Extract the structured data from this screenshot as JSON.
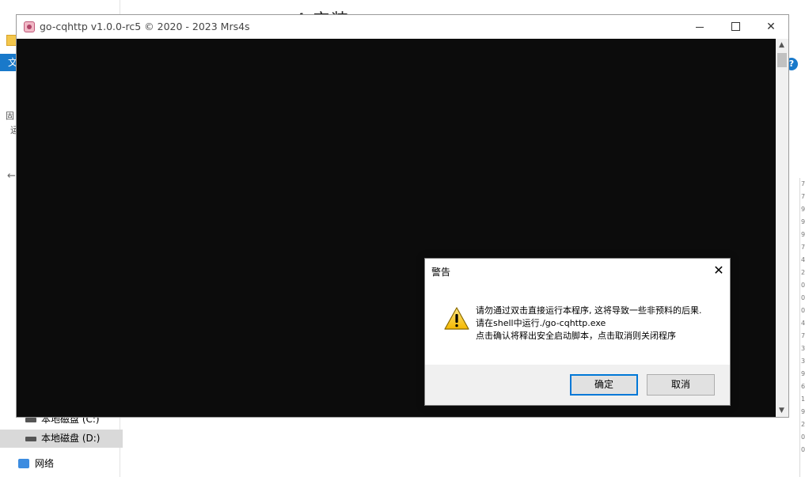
{
  "explorer": {
    "title_fragment": "4.安装 ...",
    "ribbon_tab": "文",
    "help": "?",
    "left_text_1": "固",
    "left_text_2": "运",
    "nav": [
      {
        "label": "本地磁盘 (C:)"
      },
      {
        "label": "本地磁盘 (D:)"
      },
      {
        "label": "网络"
      }
    ],
    "right_column_digits": [
      "7",
      "7",
      "9",
      "9",
      "9",
      "7",
      "4",
      "2",
      "0",
      "0",
      "0",
      "4",
      "7",
      "3",
      "3",
      "9",
      "6",
      "1",
      "9",
      "2",
      "0",
      "0."
    ]
  },
  "console": {
    "title": "go-cqhttp v1.0.0-rc5 © 2020 - 2023 Mrs4s",
    "minimize": "–",
    "maximize": "□",
    "close": "✕"
  },
  "dialog": {
    "title": "警告",
    "close": "✕",
    "message_lines": [
      "请勿通过双击直接运行本程序, 这将导致一些非预料的后果.",
      "请在shell中运行./go-cqhttp.exe",
      "点击确认将释出安全启动脚本，点击取消则关闭程序"
    ],
    "ok_label": "确定",
    "cancel_label": "取消"
  },
  "colors": {
    "console_bg": "#0c0c0c",
    "accent": "#0078d7",
    "ribbon_blue": "#1979ca"
  }
}
